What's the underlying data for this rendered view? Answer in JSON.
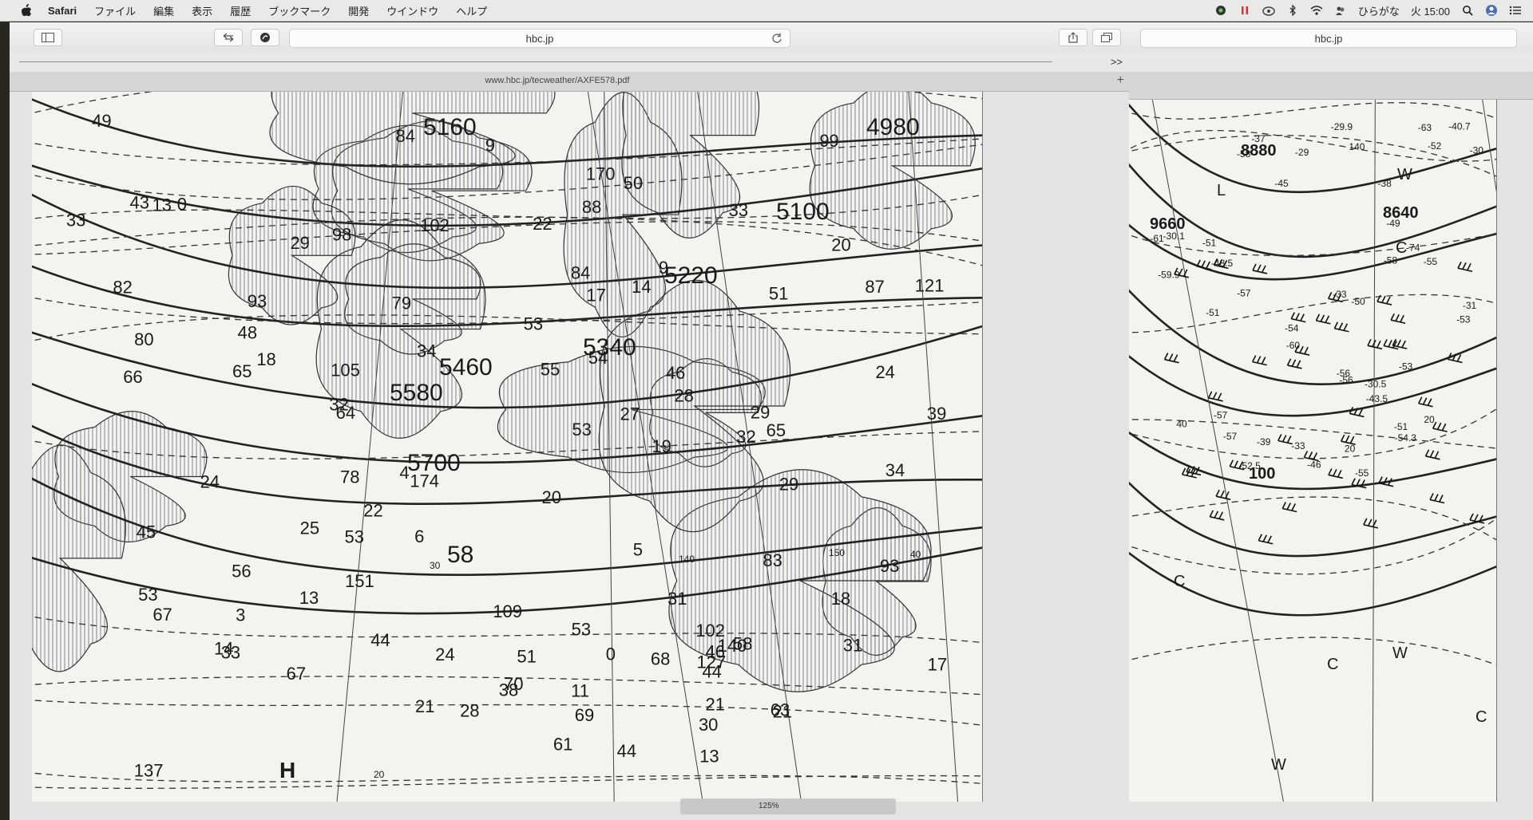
{
  "menubar": {
    "app_name": "Safari",
    "items": [
      "ファイル",
      "編集",
      "表示",
      "履歴",
      "ブックマーク",
      "開発",
      "ウインドウ",
      "ヘルプ"
    ],
    "input_method": "ひらがな",
    "clock": "火 15:00"
  },
  "window1": {
    "address": "hbc.jp",
    "tab_title": "www.hbc.jp/tecweather/AXFE578.pdf",
    "zoom": "125%",
    "favorites_overflow": ">>",
    "new_tab": "+"
  },
  "window2": {
    "address": "hbc.jp"
  },
  "map1": {
    "contours": [
      "5160",
      "4980",
      "5100",
      "5220",
      "5340",
      "5580",
      "5460",
      "5700",
      "58"
    ],
    "values": [
      "21",
      "51",
      "55",
      "33",
      "39",
      "67",
      "70",
      "45",
      "29",
      "48",
      "56",
      "31",
      "28",
      "44",
      "33",
      "69",
      "102",
      "46",
      "93",
      "65",
      "0",
      "29",
      "65",
      "64",
      "11",
      "67",
      "170",
      "61",
      "98",
      "105",
      "43",
      "31",
      "83",
      "109",
      "127",
      "79",
      "13",
      "140",
      "174",
      "25",
      "137",
      "33",
      "78",
      "53",
      "66",
      "84",
      "80",
      "6",
      "84",
      "102",
      "38",
      "82",
      "4",
      "28",
      "121",
      "44",
      "53",
      "34",
      "14",
      "44",
      "21",
      "17",
      "18",
      "29",
      "22",
      "24",
      "22",
      "51",
      "18",
      "32",
      "30",
      "9",
      "9",
      "27",
      "24",
      "3",
      "20",
      "34",
      "21",
      "32",
      "49",
      "0",
      "5",
      "88",
      "17",
      "99",
      "87",
      "93",
      "13",
      "151",
      "19",
      "53",
      "14",
      "68",
      "58",
      "63",
      "20",
      "54",
      "53",
      "50",
      "24",
      "46",
      "13",
      "53"
    ],
    "high_label": "H",
    "axis_marks": [
      "140",
      "150",
      "30",
      "40",
      "20"
    ]
  },
  "map2": {
    "contours": [
      "8880",
      "8640",
      "9660",
      "100"
    ],
    "labels": [
      "L",
      "C",
      "W",
      "C",
      "W",
      "C",
      "C",
      "W"
    ],
    "values": [
      "-55",
      "-58",
      "-57",
      "-51",
      "-74",
      "20",
      "-53",
      "-57",
      "-60",
      "-57",
      "40",
      "-61",
      "-54",
      "-56",
      "-58",
      "-63",
      "-59.9",
      "-52",
      "-53",
      "-55",
      "-51",
      "-56",
      "-52.5",
      "-54.3",
      "-50",
      "-49",
      "-51",
      "-48.5",
      "-46",
      "-45",
      "-43.5",
      "-40.7",
      "-38",
      "-39",
      "-37",
      "-33",
      "-29.9",
      "-30.1",
      "-31",
      "-30.5",
      "-29",
      "-33",
      "-30",
      "20",
      "140"
    ]
  },
  "colors": {
    "menubar": "#e9e9e7",
    "toolbar": "#ececec",
    "chart_paper": "#f3f3ef",
    "ink": "#1a1a1a"
  }
}
